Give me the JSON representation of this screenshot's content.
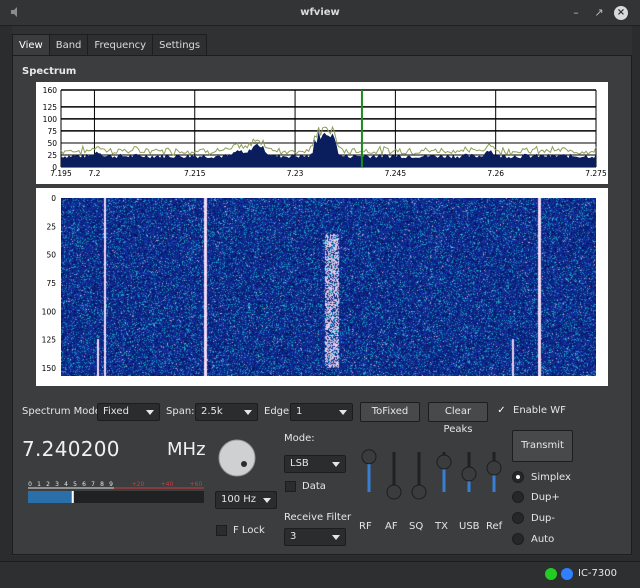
{
  "window": {
    "title": "wfview"
  },
  "tabs": [
    {
      "label": "View",
      "active": true
    },
    {
      "label": "Band"
    },
    {
      "label": "Frequency"
    },
    {
      "label": "Settings"
    }
  ],
  "spectrum": {
    "section_label": "Spectrum",
    "y_ticks": [
      "160",
      "125",
      "100",
      "75",
      "50",
      "25",
      "0"
    ],
    "x_ticks": [
      "7.195",
      "7.2",
      "7.215",
      "7.23",
      "7.245",
      "7.26",
      "7.275"
    ],
    "marker_freq": 7.24
  },
  "waterfall": {
    "y_ticks": [
      "0",
      "25",
      "50",
      "75",
      "100",
      "125",
      "150"
    ]
  },
  "controls": {
    "spectrum_mode_label": "Spectrum Mode:",
    "spectrum_mode_value": "Fixed",
    "span_label": "Span:",
    "span_value": "2.5k",
    "edge_label": "Edge",
    "edge_value": "1",
    "tofixed_label": "ToFixed",
    "clear_peaks_label": "Clear Peaks",
    "enable_wf_label": "Enable WF",
    "enable_wf_checked": true
  },
  "frequency": {
    "value": "7.240200",
    "unit": "MHz"
  },
  "meter": {
    "scale_white": [
      "0",
      "1",
      "2",
      "3",
      "4",
      "5",
      "6",
      "7",
      "8",
      "9"
    ],
    "scale_red": [
      "+20",
      "+40",
      "+60"
    ],
    "level": 0.26
  },
  "tuning": {
    "step_value": "100 Hz",
    "flock_label": "F Lock",
    "flock_checked": false
  },
  "mode": {
    "label": "Mode:",
    "value": "LSB",
    "data_label": "Data",
    "data_checked": false,
    "receive_filter_label": "Receive Filter",
    "receive_filter_value": "3"
  },
  "sliders": [
    {
      "label": "RF",
      "value": 0.88
    },
    {
      "label": "AF",
      "value": 0.0
    },
    {
      "label": "SQ",
      "value": 0.0
    },
    {
      "label": "TX",
      "value": 0.75
    },
    {
      "label": "USB",
      "value": 0.45
    },
    {
      "label": "Ref",
      "value": 0.6
    }
  ],
  "transmit": {
    "button_label": "Transmit",
    "modes": [
      {
        "label": "Simplex",
        "selected": true
      },
      {
        "label": "Dup+"
      },
      {
        "label": "Dup-"
      },
      {
        "label": "Auto"
      }
    ]
  },
  "status": {
    "radio_model": "IC-7300",
    "led_colors": [
      "#22cc22",
      "#2f7fff"
    ]
  },
  "colors": {
    "accent": "#3a7ed3",
    "spectrum_fill": "#0a1d5c",
    "spectrum_peak": "#8e9f5a",
    "marker": "#1a8c1a",
    "meter_fill": "#2b6fa8",
    "meter_red": "#d23b3b"
  }
}
